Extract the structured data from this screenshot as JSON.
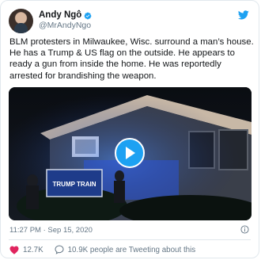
{
  "author": {
    "display_name": "Andy Ngô",
    "handle": "@MrAndyNgo",
    "verified": true
  },
  "tweet": {
    "text": "BLM protesters in Milwaukee, Wisc. surround a man’s house. He has a Trump & US flag on the outside. He appears to ready a gun from inside the home. He was reportedly arrested for brandishing the weapon.",
    "timestamp": "11:27 PM · Sep 15, 2020"
  },
  "media": {
    "type": "video",
    "sign_text": "TRUMP TRAIN"
  },
  "footer": {
    "likes": "12.7K",
    "people_tweeting": "10.9K people are Tweeting about this"
  },
  "colors": {
    "twitter_blue": "#1da1f2",
    "like_red": "#e0245e",
    "muted": "#657786"
  },
  "icons": [
    "twitter-bird-icon",
    "verified-badge-icon",
    "play-icon",
    "info-icon",
    "heart-icon",
    "speech-bubble-icon"
  ]
}
